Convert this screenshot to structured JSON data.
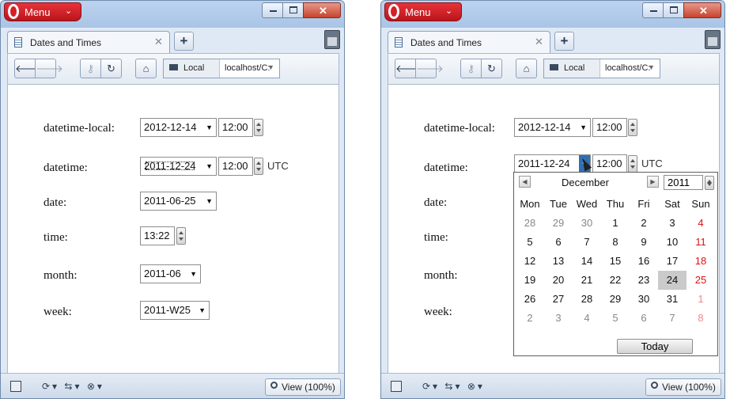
{
  "menu_label": "Menu",
  "tab_title": "Dates and Times",
  "address": {
    "badge": "Local",
    "url": "localhost/C:"
  },
  "status": {
    "view": "View (100%)"
  },
  "icons": {
    "menu_icon": "opera-o-icon",
    "tab_icon": "document-icon",
    "trash_icon": "trash-icon"
  },
  "form": {
    "datetime_local": {
      "label": "datetime-local:",
      "date": "2012-12-14",
      "time": "12:00"
    },
    "datetime": {
      "label": "datetime:",
      "date": "2011-12-24",
      "time": "12:00",
      "tz": "UTC"
    },
    "date": {
      "label": "date:",
      "value": "2011-06-25"
    },
    "time": {
      "label": "time:",
      "value": "13:22"
    },
    "month": {
      "label": "month:",
      "value": "2011-06"
    },
    "week": {
      "label": "week:",
      "value": "2011-W25"
    }
  },
  "calendar": {
    "month": "December",
    "year": "2011",
    "weekdays": [
      "Mon",
      "Tue",
      "Wed",
      "Thu",
      "Fri",
      "Sat",
      "Sun"
    ],
    "weeks": [
      [
        "28",
        "29",
        "30",
        "1",
        "2",
        "3",
        "4"
      ],
      [
        "5",
        "6",
        "7",
        "8",
        "9",
        "10",
        "11"
      ],
      [
        "12",
        "13",
        "14",
        "15",
        "16",
        "17",
        "18"
      ],
      [
        "19",
        "20",
        "21",
        "22",
        "23",
        "24",
        "25"
      ],
      [
        "26",
        "27",
        "28",
        "29",
        "30",
        "31",
        "1"
      ],
      [
        "2",
        "3",
        "4",
        "5",
        "6",
        "7",
        "8"
      ]
    ],
    "today_label": "Today"
  }
}
